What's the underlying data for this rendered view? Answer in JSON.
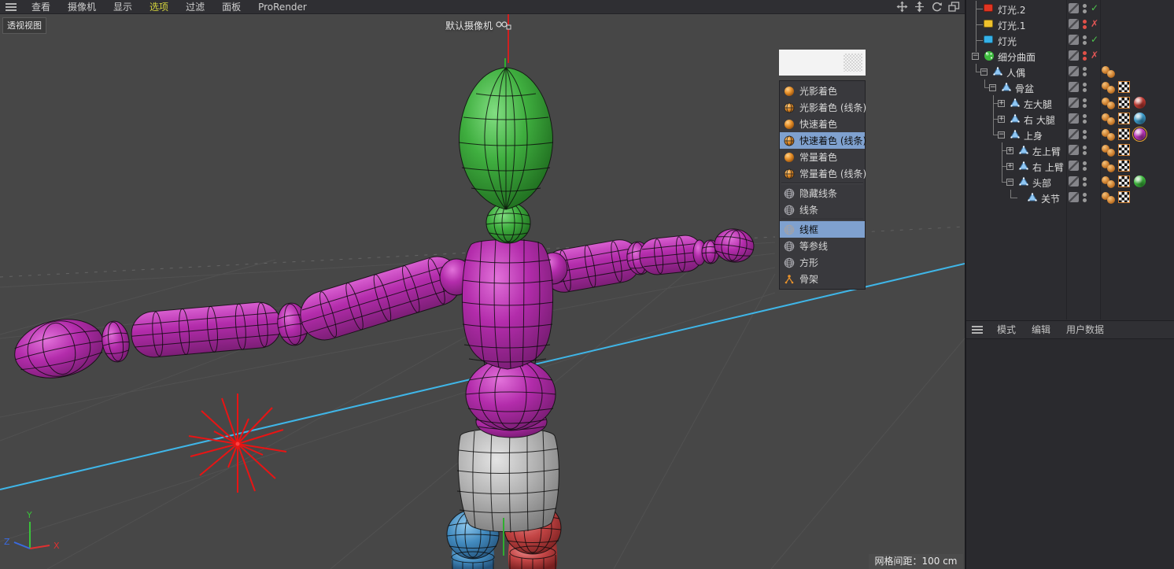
{
  "top_menu": {
    "items": [
      {
        "label": "查看",
        "active": false
      },
      {
        "label": "摄像机",
        "active": false
      },
      {
        "label": "显示",
        "active": false
      },
      {
        "label": "选项",
        "active": true
      },
      {
        "label": "过滤",
        "active": false
      },
      {
        "label": "面板",
        "active": false
      },
      {
        "label": "ProRender",
        "active": false
      }
    ]
  },
  "viewport": {
    "view_label": "透视视图",
    "camera_label": "默认摄像机",
    "grid_status": "网格间距：100 cm",
    "axis": {
      "x": "X",
      "y": "Y",
      "z": "Z"
    }
  },
  "display_menu": {
    "items": [
      {
        "label": "光影着色",
        "icon": "shaded-sphere",
        "selected": false
      },
      {
        "label": "光影着色 (线条)",
        "icon": "shaded-sphere-lines",
        "selected": false
      },
      {
        "label": "快速着色",
        "icon": "shaded-sphere",
        "selected": false
      },
      {
        "label": "快速着色 (线条)",
        "icon": "shaded-sphere-lines",
        "selected": true
      },
      {
        "label": "常量着色",
        "icon": "shaded-sphere",
        "selected": false
      },
      {
        "label": "常量着色 (线条)",
        "icon": "shaded-sphere-lines",
        "selected": false,
        "separator_after": true
      },
      {
        "label": "隐藏线条",
        "icon": "wire-sphere",
        "selected": false
      },
      {
        "label": "线条",
        "icon": "wire-sphere",
        "selected": false,
        "separator_after": true
      },
      {
        "label": "线框",
        "icon": "wire-sphere",
        "selected": true
      },
      {
        "label": "等参线",
        "icon": "wire-sphere",
        "selected": false
      },
      {
        "label": "方形",
        "icon": "wire-sphere",
        "selected": false
      },
      {
        "label": "骨架",
        "icon": "skeleton",
        "selected": false
      }
    ]
  },
  "object_manager": {
    "rows": [
      {
        "label": "灯光.2",
        "icon": "light",
        "color": "#e03522",
        "level": 0,
        "exp": "none",
        "tree": [
          {
            "level": 0,
            "type": "tee"
          }
        ],
        "dots": "gray",
        "state": "check",
        "tags": []
      },
      {
        "label": "灯光.1",
        "icon": "light",
        "color": "#eec12c",
        "level": 0,
        "exp": "none",
        "tree": [
          {
            "level": 0,
            "type": "tee"
          }
        ],
        "dots": "red",
        "state": "cross",
        "tags": []
      },
      {
        "label": "灯光",
        "icon": "light",
        "color": "#35b1e8",
        "level": 0,
        "exp": "none",
        "tree": [
          {
            "level": 0,
            "type": "tee"
          }
        ],
        "dots": "gray",
        "state": "check",
        "tags": []
      },
      {
        "label": "细分曲面",
        "icon": "subdiv",
        "level": 0,
        "exp": "minus",
        "tree": [
          {
            "level": 0,
            "type": "stub"
          }
        ],
        "dots": "red",
        "state": "cross",
        "tags": []
      },
      {
        "label": "人偶",
        "icon": "joint",
        "level": 1,
        "exp": "minus",
        "tree": [
          {
            "level": 0,
            "type": "elbow"
          }
        ],
        "dots": "gray",
        "state": "none",
        "tags": [
          {
            "type": "balls"
          }
        ]
      },
      {
        "label": "骨盆",
        "icon": "joint",
        "level": 2,
        "exp": "minus",
        "tree": [
          {
            "level": 1,
            "type": "elbow"
          }
        ],
        "dots": "gray",
        "state": "none",
        "tags": [
          {
            "type": "balls"
          },
          {
            "type": "weight"
          }
        ]
      },
      {
        "label": "左大腿",
        "icon": "joint",
        "level": 3,
        "exp": "plus",
        "tree": [
          {
            "level": 2,
            "type": "tee"
          }
        ],
        "dots": "gray",
        "state": "none",
        "tags": [
          {
            "type": "balls"
          },
          {
            "type": "weight"
          },
          {
            "type": "material",
            "color": "#c23a32",
            "selected": false
          }
        ]
      },
      {
        "label": "右 大腿",
        "icon": "joint",
        "level": 3,
        "exp": "plus",
        "tree": [
          {
            "level": 2,
            "type": "tee"
          }
        ],
        "dots": "gray",
        "state": "none",
        "tags": [
          {
            "type": "balls"
          },
          {
            "type": "weight"
          },
          {
            "type": "material",
            "color": "#3a9ccc",
            "selected": false
          }
        ]
      },
      {
        "label": "上身",
        "icon": "joint",
        "level": 3,
        "exp": "minus",
        "tree": [
          {
            "level": 2,
            "type": "elbow"
          }
        ],
        "dots": "gray",
        "state": "none",
        "tags": [
          {
            "type": "balls"
          },
          {
            "type": "weight"
          },
          {
            "type": "material",
            "color": "#c438c4",
            "selected": true
          }
        ]
      },
      {
        "label": "左上臂",
        "icon": "joint",
        "level": 4,
        "exp": "plus",
        "tree": [
          {
            "level": 3,
            "type": "tee"
          }
        ],
        "dots": "gray",
        "state": "none",
        "tags": [
          {
            "type": "balls"
          },
          {
            "type": "weight"
          }
        ]
      },
      {
        "label": "右 上臂",
        "icon": "joint",
        "level": 4,
        "exp": "plus",
        "tree": [
          {
            "level": 3,
            "type": "tee"
          }
        ],
        "dots": "gray",
        "state": "none",
        "tags": [
          {
            "type": "balls"
          },
          {
            "type": "weight"
          }
        ]
      },
      {
        "label": "头部",
        "icon": "joint",
        "level": 4,
        "exp": "minus",
        "tree": [
          {
            "level": 3,
            "type": "elbow"
          }
        ],
        "dots": "gray",
        "state": "none",
        "tags": [
          {
            "type": "balls"
          },
          {
            "type": "weight"
          },
          {
            "type": "material",
            "color": "#3cba3c",
            "selected": false
          }
        ]
      },
      {
        "label": "关节",
        "icon": "joint",
        "level": 5,
        "exp": "leaf",
        "tree": [
          {
            "level": 4,
            "type": "elbow"
          }
        ],
        "dots": "gray",
        "state": "none",
        "tags": [
          {
            "type": "balls"
          },
          {
            "type": "weight"
          }
        ]
      }
    ]
  },
  "attribute_panel": {
    "menu": [
      "模式",
      "编辑",
      "用户数据"
    ]
  },
  "colors": {
    "selection_highlight": "#7fa1cf",
    "active_menu_text": "#d4d43c",
    "axis_x": "#e03030",
    "axis_y": "#3ac23a",
    "axis_z": "#3a6ae0",
    "world_line_cyan": "#3fb6e8",
    "light_flare_red": "#e81414"
  }
}
